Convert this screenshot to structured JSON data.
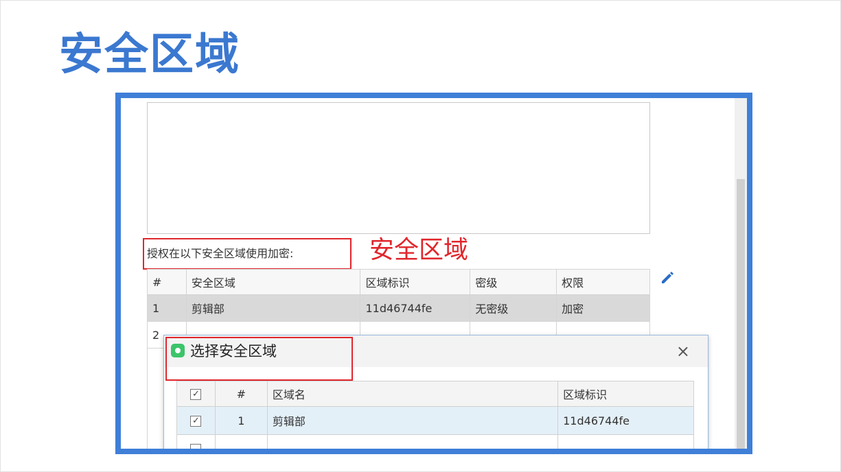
{
  "slide": {
    "title": "安全区域"
  },
  "form": {
    "auth_label": "授权在以下安全区域使用加密:",
    "annotation": "安全区域"
  },
  "zone_table": {
    "headers": [
      "#",
      "安全区域",
      "区域标识",
      "密级",
      "权限"
    ],
    "rows": [
      [
        "1",
        "剪辑部",
        "11d46744fe",
        "无密级",
        "加密"
      ],
      [
        "2",
        "",
        "",
        "",
        ""
      ]
    ]
  },
  "dialog": {
    "title": "选择安全区域",
    "close_icon": "×",
    "table": {
      "headers": [
        "",
        "#",
        "区域名",
        "区域标识"
      ],
      "rows": [
        {
          "checked": true,
          "num": "1",
          "name": "剪辑部",
          "id": "11d46744fe"
        },
        {
          "checked": false,
          "num": "",
          "name": "",
          "id": ""
        }
      ]
    }
  },
  "icons": {
    "edit": "pencil-icon",
    "close": "close-icon",
    "app": "app-icon"
  },
  "colors": {
    "title_blue": "#3b78d0",
    "frame_blue": "#3f7fd8",
    "annotation_red": "#e0262c",
    "selected_row": "#d9d9d9",
    "dialog_selected_row": "#e4f0f8"
  }
}
